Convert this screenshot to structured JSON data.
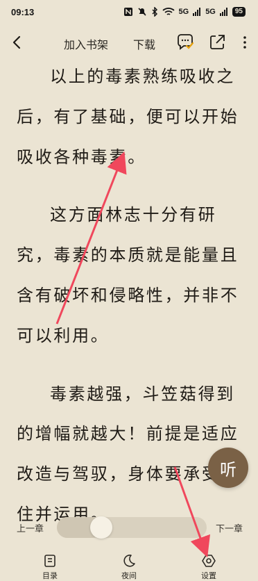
{
  "status_bar": {
    "time": "09:13",
    "signal_1": "5G",
    "signal_2": "5G",
    "battery": "95"
  },
  "toolbar": {
    "add_to_shelf": "加入书架",
    "download": "下载"
  },
  "content": {
    "paragraphs": [
      "以上的毒素熟练吸收之后，有了基础，便可以开始吸收各种毒素。",
      "这方面林志十分有研究，毒素的本质就是能量且含有破坏和侵略性，并非不可以利用。",
      "毒素越强，斗笠菇得到的增幅就越大！前提是适应改造与驾驭，身体要承受的住并运用。"
    ]
  },
  "listen_button": {
    "label": "听"
  },
  "progress": {
    "prev_chapter": "上一章",
    "next_chapter": "下一章",
    "value": 0.26
  },
  "bottom_nav": {
    "toc": "目录",
    "night": "夜间",
    "settings": "设置"
  },
  "colors": {
    "background": "#ebe4d3",
    "listen_button": "#7a6146",
    "annotation_arrow": "#f0475c",
    "comment_badge": "#e8a20a"
  }
}
